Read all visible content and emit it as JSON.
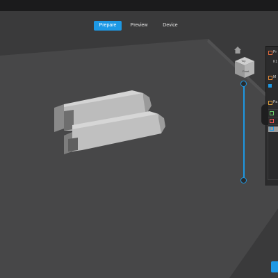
{
  "tabs": [
    {
      "label": "Prepare",
      "active": true
    },
    {
      "label": "Preview",
      "active": false
    },
    {
      "label": "Device",
      "active": false
    }
  ],
  "view_cube": {
    "top_label": "Top",
    "front_label": "Front"
  },
  "right_panel": {
    "section1_prefix": "Pr",
    "printer_prefix": "K1",
    "section2_prefix": "M",
    "section3_prefix": "Pa"
  },
  "colors": {
    "accent": "#1d98e4",
    "bed": "#474748",
    "background": "#3a3a3b",
    "model": "#c2c2c2"
  },
  "icons": [
    "home-icon",
    "view-cube-icon",
    "printer-icon",
    "material-icon",
    "parameter-icon"
  ]
}
